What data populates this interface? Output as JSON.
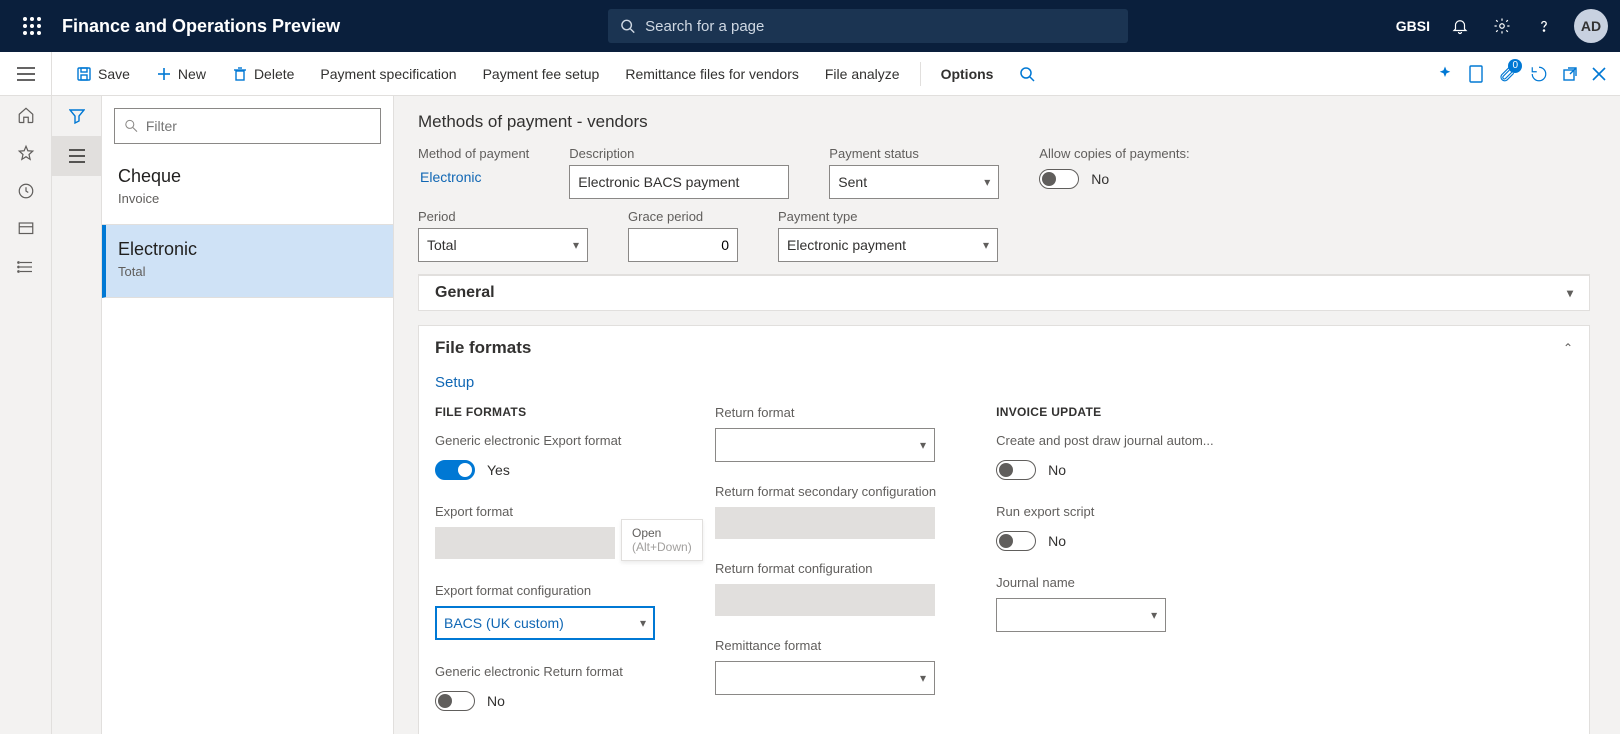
{
  "header": {
    "app_title": "Finance and Operations Preview",
    "search_placeholder": "Search for a page",
    "company": "GBSI",
    "avatar": "AD",
    "attach_badge": "0"
  },
  "actions": {
    "save": "Save",
    "new": "New",
    "delete": "Delete",
    "payment_spec": "Payment specification",
    "payment_fee": "Payment fee setup",
    "remittance": "Remittance files for vendors",
    "file_analyze": "File analyze",
    "options": "Options"
  },
  "list": {
    "filter_placeholder": "Filter",
    "items": [
      {
        "title": "Cheque",
        "sub": "Invoice"
      },
      {
        "title": "Electronic",
        "sub": "Total"
      }
    ],
    "selected_index": 1
  },
  "page": {
    "title": "Methods of payment - vendors"
  },
  "fields": {
    "method_of_payment": {
      "label": "Method of payment",
      "value": "Electronic"
    },
    "description": {
      "label": "Description",
      "value": "Electronic BACS payment"
    },
    "payment_status": {
      "label": "Payment status",
      "value": "Sent"
    },
    "allow_copies": {
      "label": "Allow copies of payments:",
      "value": "No",
      "on": false
    },
    "period": {
      "label": "Period",
      "value": "Total"
    },
    "grace_period": {
      "label": "Grace period",
      "value": "0"
    },
    "payment_type": {
      "label": "Payment type",
      "value": "Electronic payment"
    }
  },
  "sections": {
    "general": "General",
    "file_formats": "File formats",
    "setup": "Setup"
  },
  "file_formats": {
    "heading": "FILE FORMATS",
    "generic_export": {
      "label": "Generic electronic Export format",
      "value": "Yes",
      "on": true
    },
    "export_format": {
      "label": "Export format",
      "value": "",
      "open_hint": "Open",
      "alt_hint": "(Alt+Down)"
    },
    "export_format_config": {
      "label": "Export format configuration",
      "value": "BACS (UK custom)"
    },
    "generic_return": {
      "label": "Generic electronic Return format",
      "value": "No",
      "on": false
    },
    "return_format": {
      "label": "Return format",
      "value": ""
    },
    "return_secondary": {
      "label": "Return format secondary configuration",
      "value": ""
    },
    "return_config": {
      "label": "Return format configuration",
      "value": ""
    },
    "remittance_format": {
      "label": "Remittance format",
      "value": ""
    }
  },
  "invoice_update": {
    "heading": "INVOICE UPDATE",
    "create_post": {
      "label": "Create and post draw journal autom...",
      "value": "No",
      "on": false
    },
    "run_export": {
      "label": "Run export script",
      "value": "No",
      "on": false
    },
    "journal_name": {
      "label": "Journal name",
      "value": ""
    }
  }
}
